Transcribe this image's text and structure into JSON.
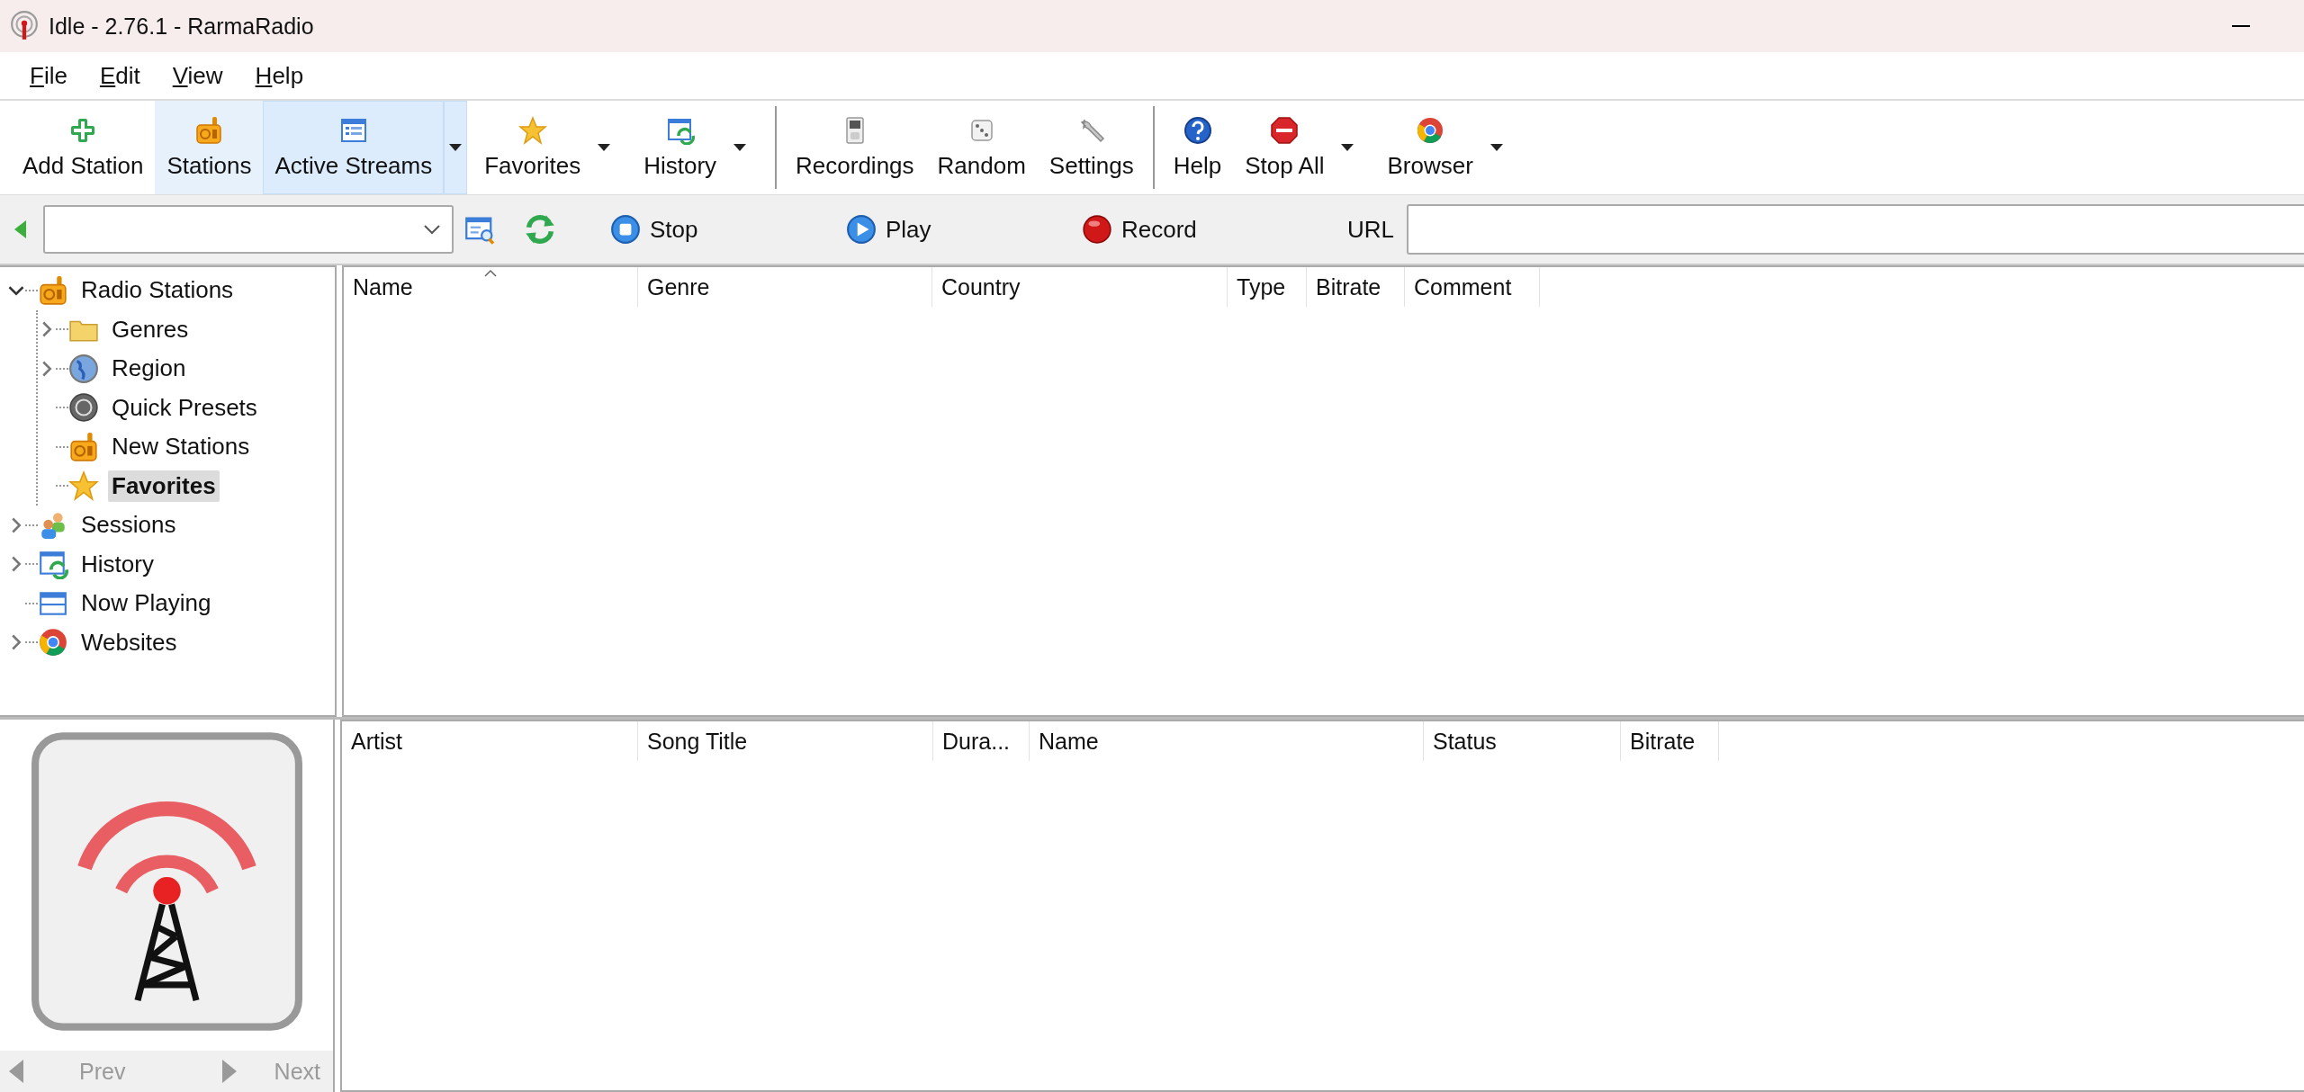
{
  "window": {
    "title": "Idle - 2.76.1 - RarmaRadio"
  },
  "menu": [
    {
      "label": "File"
    },
    {
      "label": "Edit"
    },
    {
      "label": "View"
    },
    {
      "label": "Help"
    }
  ],
  "toolbar": [
    {
      "kind": "button",
      "label": "Add Station",
      "selected": false,
      "hover": false,
      "dropdown": false
    },
    {
      "kind": "button",
      "label": "Stations",
      "selected": false,
      "hover": true,
      "dropdown": false
    },
    {
      "kind": "button",
      "label": "Active Streams",
      "selected": true,
      "hover": false,
      "dropdown": true
    },
    {
      "kind": "button",
      "label": "Favorites",
      "selected": false,
      "hover": false,
      "dropdown": true
    },
    {
      "kind": "button",
      "label": "History",
      "selected": false,
      "hover": false,
      "dropdown": true
    },
    {
      "kind": "separator"
    },
    {
      "kind": "button",
      "label": "Recordings",
      "selected": false,
      "hover": false,
      "dropdown": false
    },
    {
      "kind": "button",
      "label": "Random",
      "selected": false,
      "hover": false,
      "dropdown": false
    },
    {
      "kind": "button",
      "label": "Settings",
      "selected": false,
      "hover": false,
      "dropdown": false
    },
    {
      "kind": "separator"
    },
    {
      "kind": "button",
      "label": "Help",
      "selected": false,
      "hover": false,
      "dropdown": false
    },
    {
      "kind": "button",
      "label": "Stop All",
      "selected": false,
      "hover": false,
      "dropdown": true
    },
    {
      "kind": "button",
      "label": "Browser",
      "selected": false,
      "hover": false,
      "dropdown": true
    }
  ],
  "address_bar": {
    "actions": [
      {
        "label": "Stop"
      },
      {
        "label": "Play"
      },
      {
        "label": "Record"
      }
    ],
    "url_label": "URL"
  },
  "tree": [
    {
      "label": "Radio Stations",
      "expanded": true,
      "selected": false,
      "children": [
        {
          "label": "Genres",
          "expanded": false,
          "selected": false
        },
        {
          "label": "Region",
          "expanded": false,
          "selected": false
        },
        {
          "label": "Quick Presets",
          "selected": false
        },
        {
          "label": "New Stations",
          "selected": false
        },
        {
          "label": "Favorites",
          "selected": true
        }
      ]
    },
    {
      "label": "Sessions",
      "expanded": false,
      "selected": false
    },
    {
      "label": "History",
      "expanded": false,
      "selected": false
    },
    {
      "label": "Now Playing",
      "selected": false
    },
    {
      "label": "Websites",
      "expanded": false,
      "selected": false
    }
  ],
  "stations_table": {
    "columns": [
      {
        "label": "Name",
        "sorted": true
      },
      {
        "label": "Genre",
        "sorted": false
      },
      {
        "label": "Country",
        "sorted": false
      },
      {
        "label": "Type",
        "sorted": false
      },
      {
        "label": "Bitrate",
        "sorted": false
      },
      {
        "label": "Comment",
        "sorted": false
      }
    ]
  },
  "streams_table": {
    "columns": [
      {
        "label": "Artist"
      },
      {
        "label": "Song Title"
      },
      {
        "label": "Dura..."
      },
      {
        "label": "Name"
      },
      {
        "label": "Status"
      },
      {
        "label": "Bitrate"
      }
    ]
  },
  "artwork_nav": [
    {
      "label": "Prev",
      "disabled": true
    },
    {
      "label": "Next",
      "disabled": true
    }
  ]
}
